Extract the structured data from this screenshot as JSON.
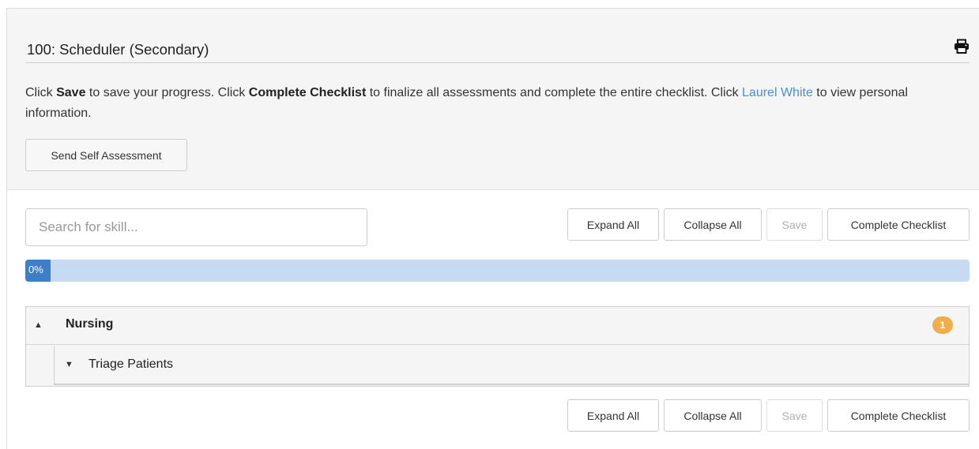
{
  "header": {
    "title": "100: Scheduler (Secondary)",
    "print_icon": "print-icon"
  },
  "instructions": {
    "p1": "Click ",
    "save_word": "Save",
    "p2": " to save your progress. Click ",
    "complete_word": "Complete Checklist",
    "p3": " to finalize all assessments and complete the entire checklist. Click ",
    "person_name": "Laurel White",
    "p4": " to view personal information."
  },
  "send_self_assessment_label": "Send Self Assessment",
  "search": {
    "placeholder": "Search for skill...",
    "value": ""
  },
  "toolbar": {
    "expand_all": "Expand All",
    "collapse_all": "Collapse All",
    "save": "Save",
    "complete_checklist": "Complete Checklist"
  },
  "progress": {
    "value": 0,
    "label": "0%"
  },
  "sections": [
    {
      "title": "Nursing",
      "toggle": "▲",
      "badge": "1",
      "items": [
        {
          "title": "Triage Patients",
          "toggle": "▼"
        }
      ]
    }
  ],
  "colors": {
    "accent": "#3d7ec4",
    "progress_track": "#c6dbf2",
    "badge": "#f0ad4e",
    "link": "#4a8fd4"
  }
}
